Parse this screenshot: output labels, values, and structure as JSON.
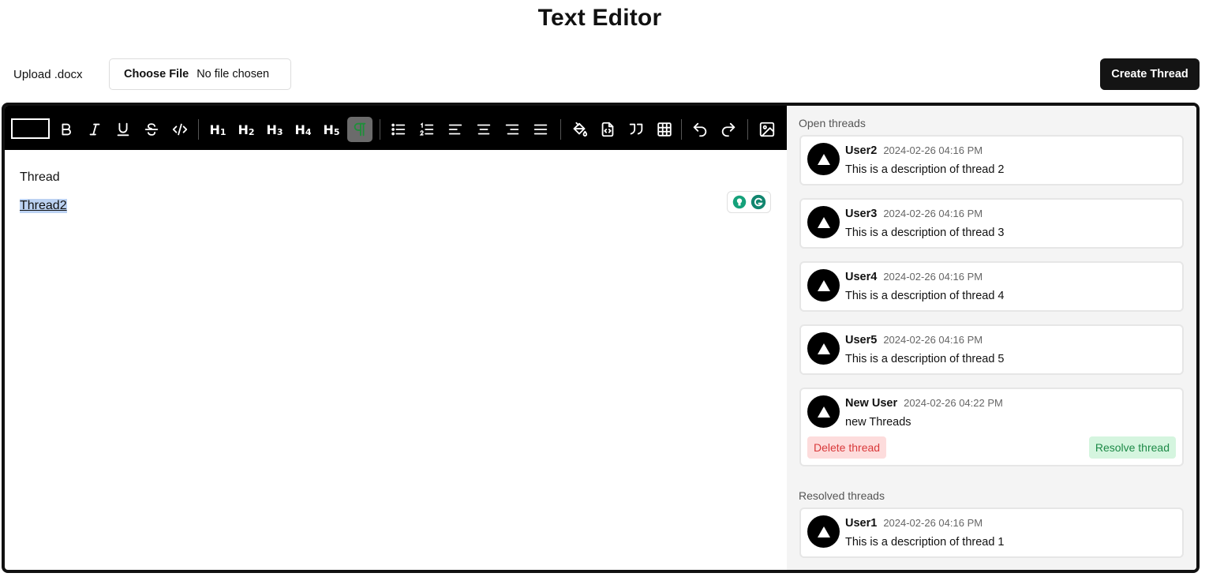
{
  "page": {
    "title": "Text Editor"
  },
  "upload": {
    "label": "Upload .docx",
    "button": "Choose File",
    "status": "No file chosen"
  },
  "actions": {
    "create_thread": "Create Thread"
  },
  "toolbar": {
    "buttons": [
      "block-style",
      "bold",
      "italic",
      "underline",
      "strikethrough",
      "code",
      "h1",
      "h2",
      "h3",
      "h4",
      "h5",
      "paragraph",
      "bullet-list",
      "numbered-list",
      "align-left",
      "align-center",
      "align-right",
      "justify",
      "fill-color",
      "code-block",
      "quote",
      "table",
      "undo",
      "redo",
      "image"
    ],
    "active": "paragraph",
    "headings": [
      "H",
      "H",
      "H",
      "H",
      "H"
    ],
    "heading_numbers": [
      "1",
      "2",
      "3",
      "4",
      "5"
    ]
  },
  "editor": {
    "lines": [
      "Thread",
      "Thread2"
    ]
  },
  "threads": {
    "open_title": "Open threads",
    "resolved_title": "Resolved threads",
    "open": [
      {
        "user": "User2",
        "time": "2024-02-26 04:16 PM",
        "description": "This is a description of thread 2"
      },
      {
        "user": "User3",
        "time": "2024-02-26 04:16 PM",
        "description": "This is a description of thread 3"
      },
      {
        "user": "User4",
        "time": "2024-02-26 04:16 PM",
        "description": "This is a description of thread 4"
      },
      {
        "user": "User5",
        "time": "2024-02-26 04:16 PM",
        "description": "This is a description of thread 5"
      },
      {
        "user": "New User",
        "time": "2024-02-26 04:22 PM",
        "description": "new Threads",
        "delete_label": "Delete thread",
        "resolve_label": "Resolve thread"
      }
    ],
    "resolved": [
      {
        "user": "User1",
        "time": "2024-02-26 04:16 PM",
        "description": "This is a description of thread 1"
      }
    ]
  },
  "colors": {
    "toolbar_bg": "#000000",
    "sidebar_bg": "#f4f4f4",
    "delete": "#d9393a",
    "resolve": "#1d8a47",
    "selection": "#bcd2f2"
  }
}
